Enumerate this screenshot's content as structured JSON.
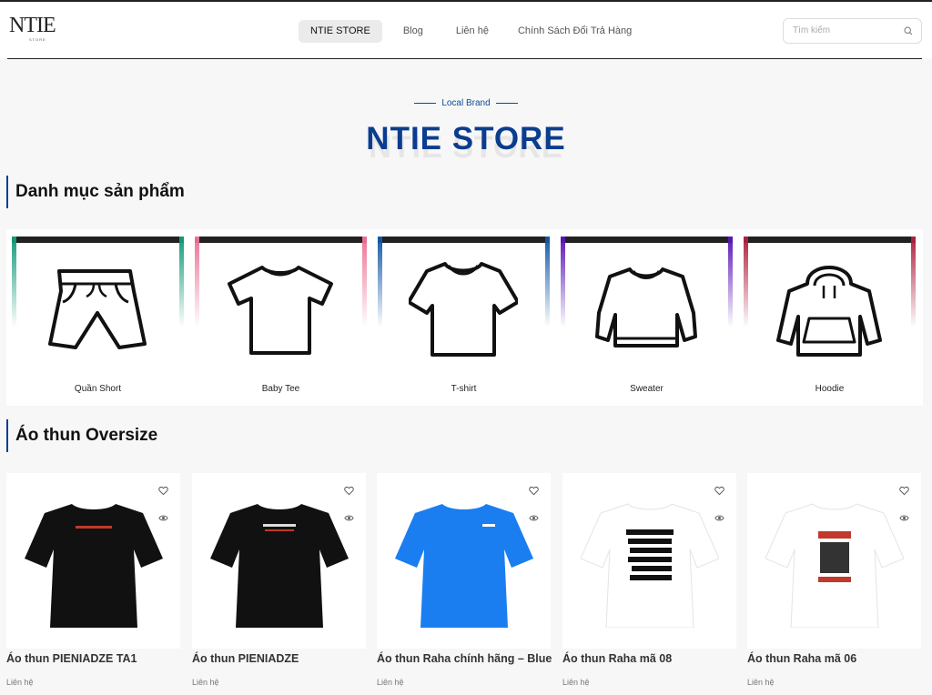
{
  "header": {
    "logo": "NTIE",
    "logo_sub": "STORE",
    "nav": [
      "NTIE STORE",
      "Blog",
      "Liên hệ",
      "Chính Sách Đổi Trả Hàng"
    ],
    "search_placeholder": "Tìm kiếm"
  },
  "hero": {
    "tag": "Local Brand",
    "title": "NTIE STORE"
  },
  "categories_section": {
    "title": "Danh mục sản phẩm",
    "items": [
      {
        "label": "Quần Short",
        "color": "#139c7a"
      },
      {
        "label": "Baby Tee",
        "color": "#ec7496"
      },
      {
        "label": "T-shirt",
        "color": "#1259a6"
      },
      {
        "label": "Sweater",
        "color": "#5b16b8"
      },
      {
        "label": "Hoodie",
        "color": "#b0203f"
      }
    ]
  },
  "products_section": {
    "title": "Áo thun Oversize",
    "items": [
      {
        "name": "Áo thun PIENIADZE TA1",
        "contact": "Liên hệ"
      },
      {
        "name": "Áo thun PIENIADZE",
        "contact": "Liên hệ"
      },
      {
        "name": "Áo thun Raha chính hãng – Blue",
        "contact": "Liên hệ"
      },
      {
        "name": "Áo thun Raha mã 08",
        "contact": "Liên hệ"
      },
      {
        "name": "Áo thun Raha mã 06",
        "contact": "Liên hệ"
      }
    ]
  },
  "colors": {
    "brand_blue": "#0a3d8f",
    "shirt_black": "#111111",
    "shirt_blue": "#1a7ef0",
    "shirt_white": "#ffffff"
  }
}
